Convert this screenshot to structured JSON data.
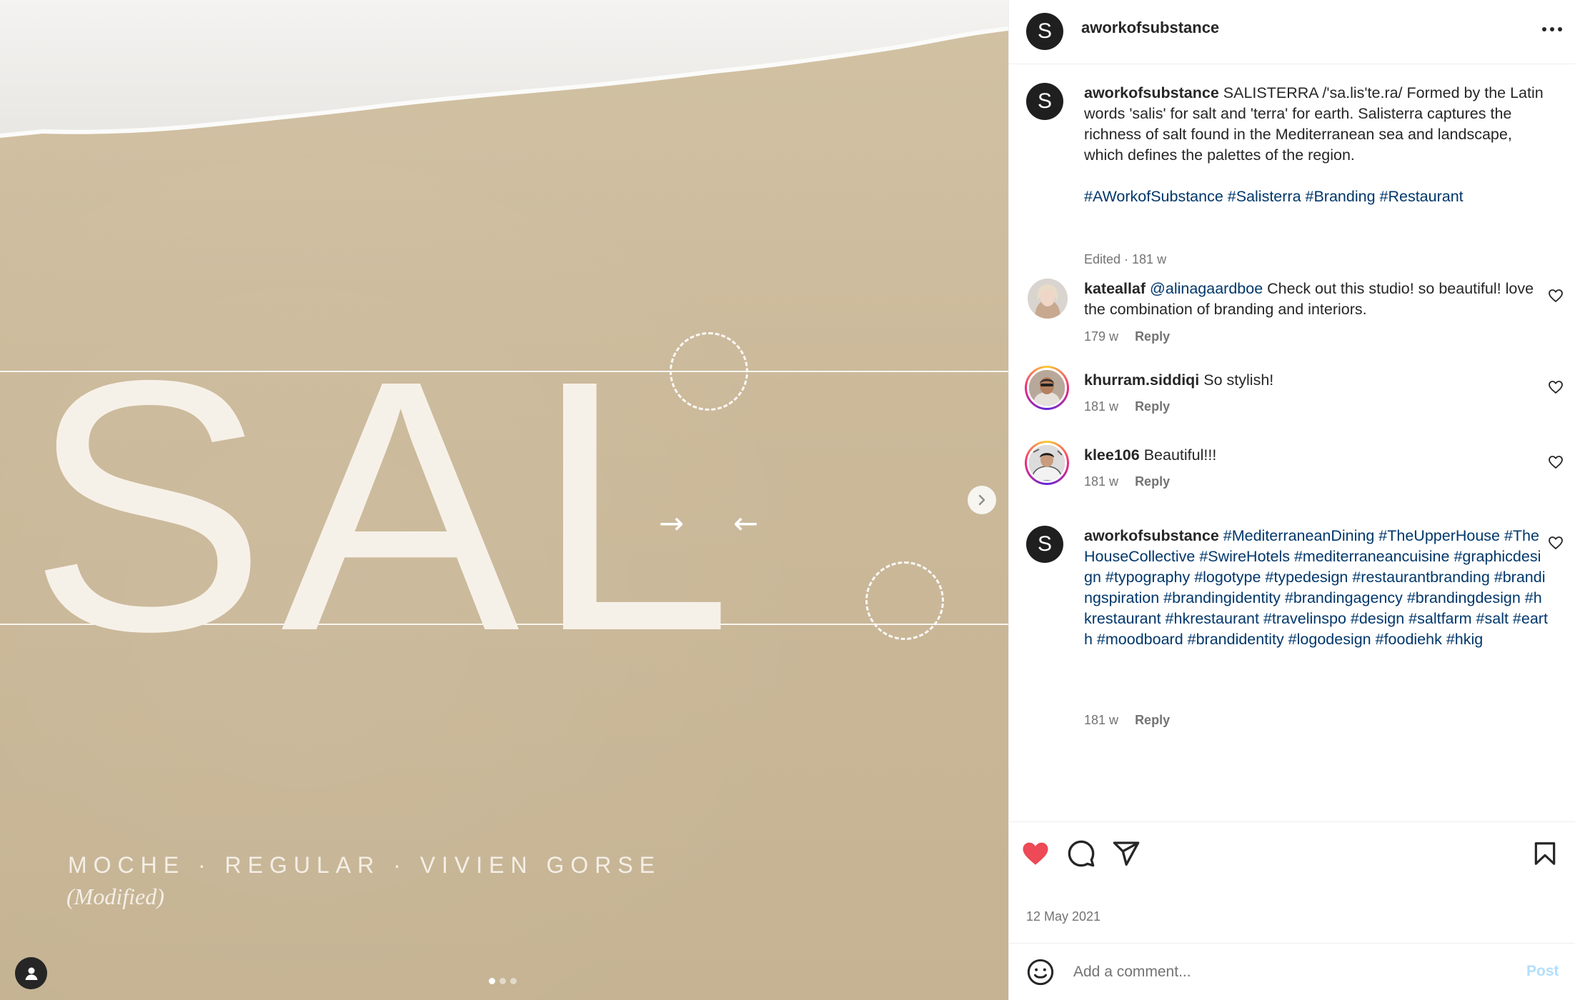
{
  "post": {
    "username": "aworkofsubstance",
    "avatar_letter": "S",
    "date": "12 May 2021"
  },
  "media": {
    "big_text": "SAL",
    "caption_main": "MOCHE · REGULAR · VIVIEN GORSE",
    "caption_sub": "(Modified)",
    "slide_count": 3,
    "active_slide": 1,
    "icons": {
      "next": "chevron-right-icon",
      "tagged_user": "user-icon"
    }
  },
  "caption": {
    "username": "aworkofsubstance",
    "text": "SALISTERRA /'sa.lis'te.ra/ Formed by the Latin words 'salis' for salt and 'terra' for earth. Salisterra captures the richness of salt found in the Mediterranean sea and landscape, which defines the palettes of the region.",
    "hashtags": "#AWorkofSubstance #Salisterra #Branding #Restaurant",
    "meta": "Edited · 181 w"
  },
  "comments": [
    {
      "username": "kateallaf",
      "mention": "@alinagaardboe",
      "text": " Check out this studio! so beautiful! love the combination of branding and interiors.",
      "time": "179 w",
      "reply": "Reply"
    },
    {
      "username": "khurram.siddiqi",
      "text": "So stylish!",
      "time": "181 w",
      "reply": "Reply"
    },
    {
      "username": "klee106",
      "text": "Beautiful!!!",
      "time": "181 w",
      "reply": "Reply"
    },
    {
      "username": "aworkofsubstance",
      "avatar_letter": "S",
      "hashtags": "#MediterraneanDining #TheUpperHouse #TheHouseCollective #SwireHotels #mediterraneancuisine #graphicdesign #typography #logotype #typedesign #restaurantbranding #brandingspiration #brandingidentity #brandingagency #brandingdesign #hkrestaurant #hkrestaurant #travelinspo #design #saltfarm #salt #earth #moodboard #brandidentity #logodesign #foodiehk #hkig",
      "time": "181 w",
      "reply": "Reply"
    }
  ],
  "actions": {
    "like_color": "#ed4956",
    "icons": [
      "heart-filled-icon",
      "comment-icon",
      "share-icon",
      "bookmark-icon"
    ]
  },
  "comment_box": {
    "placeholder": "Add a comment...",
    "post_label": "Post",
    "post_color": "#b2dffc"
  }
}
